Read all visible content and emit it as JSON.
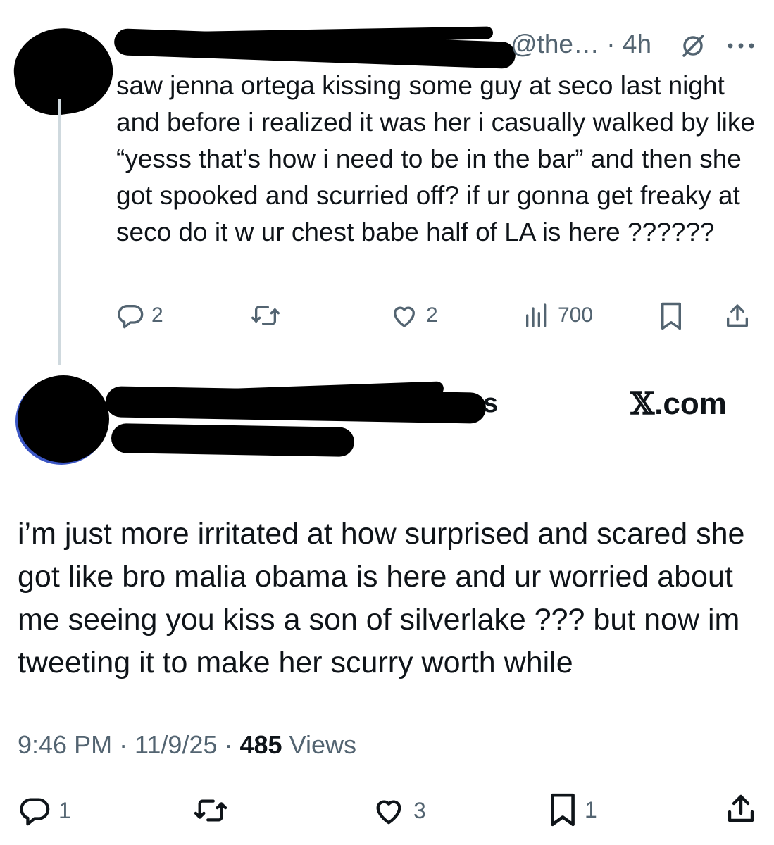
{
  "reply": {
    "handle_time": "@the… · 4h",
    "text": "saw jenna ortega kissing some guy at seco last night and before i realized it was her i casually walked by like “yesss that’s how i need to be in the bar” and then she got spooked and scurried off? if ur gonna get freaky at seco do it w ur chest babe half of LA is here ??????",
    "actions": {
      "replies": "2",
      "likes": "2",
      "views": "700"
    }
  },
  "main": {
    "tail_letters": "s",
    "source_label": ".com",
    "source_mark": "𝕏",
    "text": "i’m just more irritated at how surprised and scared she got like bro malia obama is here and ur worried about me seeing you kiss a son of silverlake ??? but now im tweeting it to make her scurry worth while",
    "time": "9:46 PM · 11/9/25 · ",
    "views_count": "485",
    "views_label": " Views",
    "actions": {
      "replies": "1",
      "likes": "3",
      "bookmarks": "1"
    }
  },
  "icons": [
    "reply-icon",
    "retweet-icon",
    "like-icon",
    "views-icon",
    "bookmark-icon",
    "share-icon",
    "grok-icon",
    "more-icon"
  ],
  "colors": {
    "text": "#0f1419",
    "muted": "#536471",
    "thread_line": "#cfd9de"
  }
}
